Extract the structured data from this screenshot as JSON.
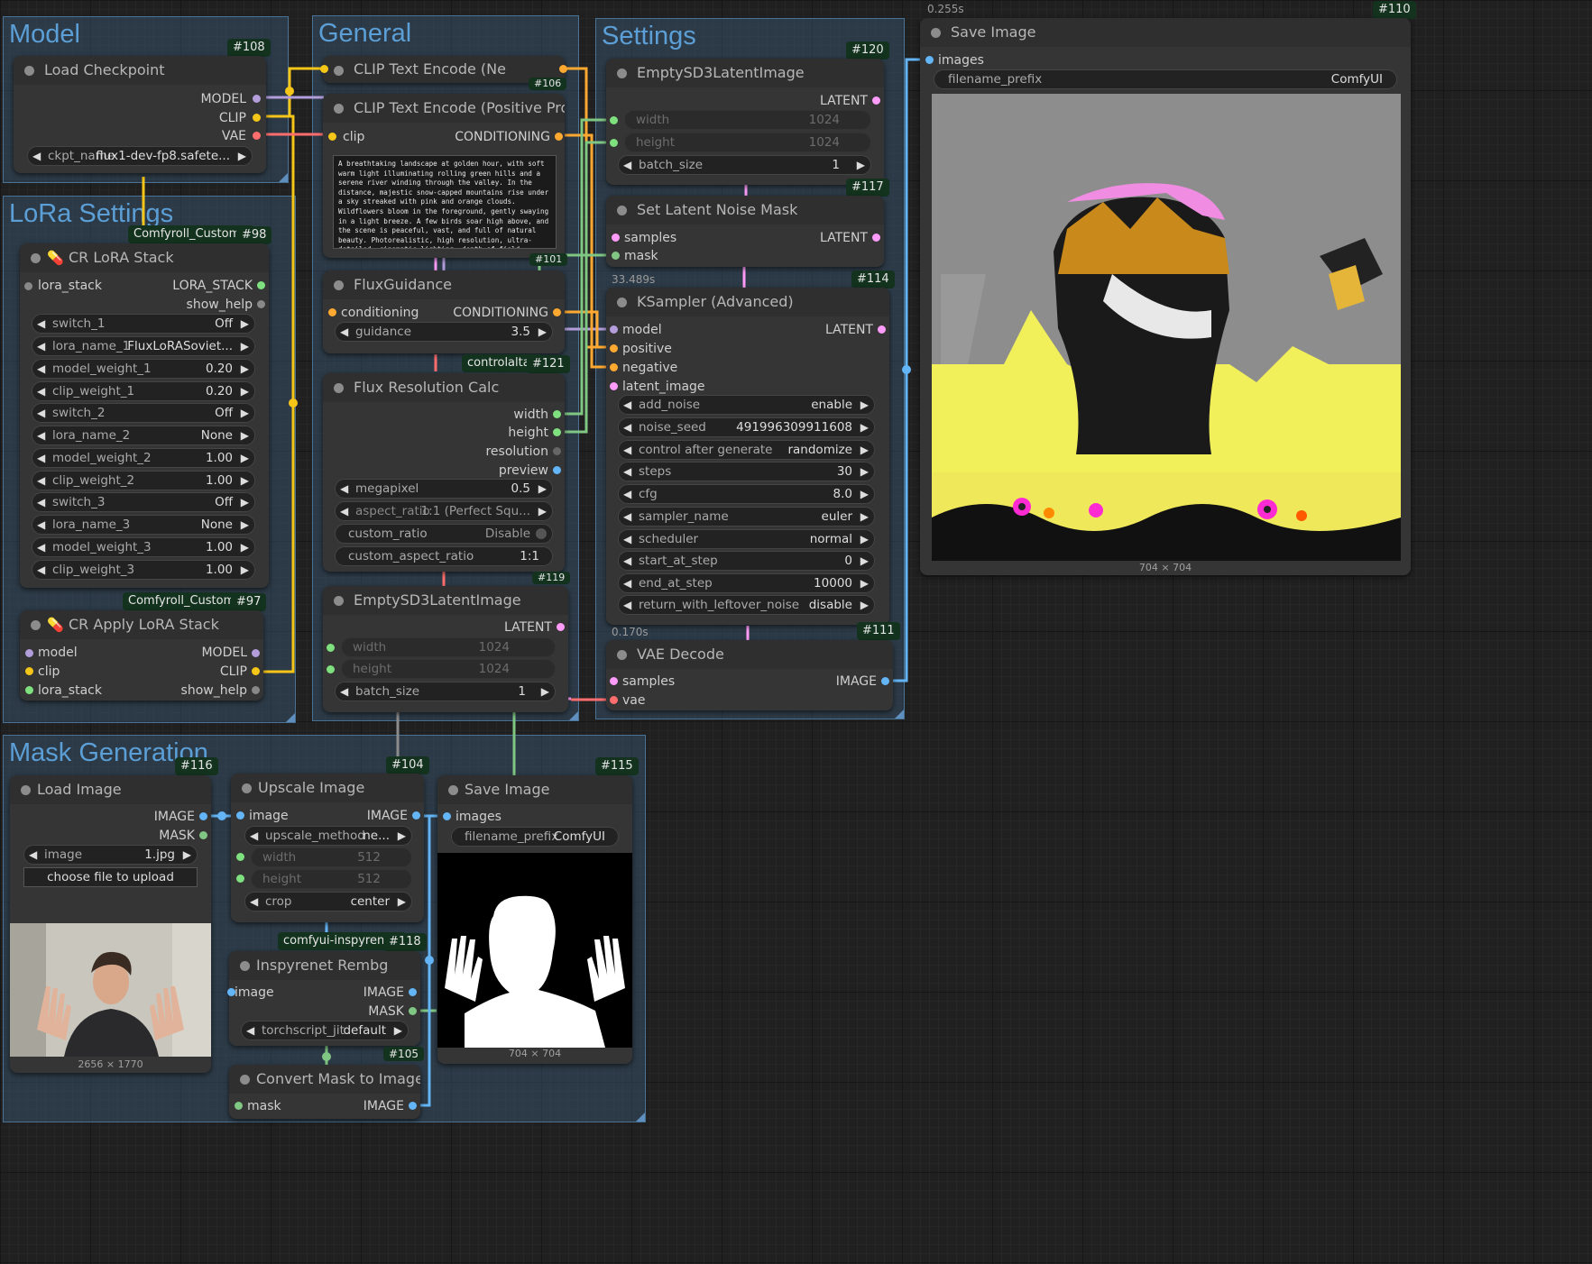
{
  "groups": {
    "model": "Model",
    "general": "General",
    "settings": "Settings",
    "lora": "LoRa Settings",
    "mask": "Mask Generation"
  },
  "colors": {
    "model": "#b39ddb",
    "clip": "#f5c518",
    "vae": "#ff6e6e",
    "conditioning": "#ffa931",
    "latent": "#ff9cf9",
    "image": "#64b5f6",
    "mask": "#81c784",
    "int": "#7fe07f",
    "lora_stack": "#7fe07f",
    "group_title": "#5b9fd6"
  },
  "nodes": {
    "load_checkpoint": {
      "id": "#108",
      "title": "Load Checkpoint",
      "outputs": [
        "MODEL",
        "CLIP",
        "VAE"
      ],
      "ckpt_label": "ckpt_name",
      "ckpt_value": "flux1-dev-fp8.safete..."
    },
    "clip_neg": {
      "title": "CLIP Text Encode (Ne",
      "id": "#106"
    },
    "clip_pos": {
      "title": "CLIP Text Encode (Positive Prompt)",
      "id": "#101",
      "input": "clip",
      "output": "CONDITIONING",
      "text": "A breathtaking landscape at golden hour, with soft warm light illuminating rolling green hills and a serene river winding through the valley. In the distance, majestic snow-capped mountains rise under a sky streaked with pink and orange clouds. Wildflowers bloom in the foreground, gently swaying in a light breeze. A few birds soar high above, and the scene is peaceful, vast, and full of natural beauty. Photorealistic, high resolution, ultra-detailed, cinematic lighting, depth of field."
    },
    "flux_guidance": {
      "title": "FluxGuidance",
      "id": "#121",
      "input": "conditioning",
      "output": "CONDITIONING",
      "w_label": "guidance",
      "w_value": "3.5",
      "next_badge": "controlaltai-"
    },
    "flux_res": {
      "title": "Flux Resolution Calc",
      "id": "#119",
      "outputs": [
        "width",
        "height",
        "resolution",
        "preview"
      ],
      "megapixel": "0.5",
      "aspect_ratio": "1:1 (Perfect Squ...",
      "custom_ratio": "Disable",
      "custom_aspect_ratio": "1:1"
    },
    "empty_gen": {
      "title": "EmptySD3LatentImage",
      "output": "LATENT",
      "width": "1024",
      "height": "1024",
      "batch_size": "1"
    },
    "empty_settings": {
      "title": "EmptySD3LatentImage",
      "id": "#120",
      "output": "LATENT",
      "width": "1024",
      "height": "1024",
      "batch_size": "1"
    },
    "noise_mask": {
      "title": "Set Latent Noise Mask",
      "id": "#117",
      "inputs": [
        "samples",
        "mask"
      ],
      "output": "LATENT",
      "timing": "33.489s"
    },
    "ksampler": {
      "title": "KSampler (Advanced)",
      "id": "#114",
      "inputs": [
        "model",
        "positive",
        "negative",
        "latent_image"
      ],
      "output": "LATENT",
      "widgets": [
        {
          "label": "add_noise",
          "value": "enable"
        },
        {
          "label": "noise_seed",
          "value": "491996309911608"
        },
        {
          "label": "control after generate",
          "value": "randomize"
        },
        {
          "label": "steps",
          "value": "30"
        },
        {
          "label": "cfg",
          "value": "8.0"
        },
        {
          "label": "sampler_name",
          "value": "euler"
        },
        {
          "label": "scheduler",
          "value": "normal"
        },
        {
          "label": "start_at_step",
          "value": "0"
        },
        {
          "label": "end_at_step",
          "value": "10000"
        },
        {
          "label": "return_with_leftover_noise",
          "value": "disable"
        }
      ],
      "timing": "0.170s"
    },
    "vae_decode": {
      "title": "VAE Decode",
      "id": "#111",
      "inputs": [
        "samples",
        "vae"
      ],
      "output": "IMAGE"
    },
    "save_main": {
      "title": "Save Image",
      "id": "#110",
      "timing": "0.255s",
      "input": "images",
      "prefix_label": "filename_prefix",
      "prefix_value": "ComfyUI",
      "caption": "704 × 704"
    },
    "lora_stack": {
      "title": "CR LoRA Stack",
      "id": "#98",
      "header_badge": "Comfyroll_CustomN",
      "input": "lora_stack",
      "outputs": [
        "LORA_STACK",
        "show_help"
      ],
      "widgets": [
        {
          "label": "switch_1",
          "value": "Off"
        },
        {
          "label": "lora_name_1",
          "value": "FluxLoRASoviet..."
        },
        {
          "label": "model_weight_1",
          "value": "0.20"
        },
        {
          "label": "clip_weight_1",
          "value": "0.20"
        },
        {
          "label": "switch_2",
          "value": "Off"
        },
        {
          "label": "lora_name_2",
          "value": "None"
        },
        {
          "label": "model_weight_2",
          "value": "1.00"
        },
        {
          "label": "clip_weight_2",
          "value": "1.00"
        },
        {
          "label": "switch_3",
          "value": "Off"
        },
        {
          "label": "lora_name_3",
          "value": "None"
        },
        {
          "label": "model_weight_3",
          "value": "1.00"
        },
        {
          "label": "clip_weight_3",
          "value": "1.00"
        }
      ]
    },
    "apply_lora": {
      "title": "CR Apply LoRA Stack",
      "id": "#97",
      "header_badge": "Comfyroll_CustomN",
      "inputs": [
        "model",
        "clip",
        "lora_stack"
      ],
      "outputs": [
        "MODEL",
        "CLIP",
        "show_help"
      ]
    },
    "load_image": {
      "title": "Load Image",
      "id": "#116",
      "outputs": [
        "IMAGE",
        "MASK"
      ],
      "image_label": "image",
      "image_value": "1.jpg",
      "upload_label": "choose file to upload",
      "caption": "2656 × 1770"
    },
    "upscale": {
      "title": "Upscale Image",
      "id": "#104",
      "input": "image",
      "output": "IMAGE",
      "upscale_method": "ne...",
      "width": "512",
      "height": "512",
      "crop": "center"
    },
    "save_mask": {
      "title": "Save Image",
      "id": "#115",
      "input": "images",
      "prefix_label": "filename_prefix",
      "prefix_value": "ComfyUI",
      "caption": "704 × 704"
    },
    "inspyrenet": {
      "title": "Inspyrenet Rembg",
      "id": "#118",
      "header_badge": "comfyui-inspyrenet-",
      "input": "image",
      "outputs": [
        "IMAGE",
        "MASK"
      ],
      "w_label": "torchscript_jit",
      "w_value": "default"
    },
    "convert_mask": {
      "title": "Convert Mask to Image",
      "id": "#105",
      "input": "mask",
      "output": "IMAGE"
    }
  }
}
